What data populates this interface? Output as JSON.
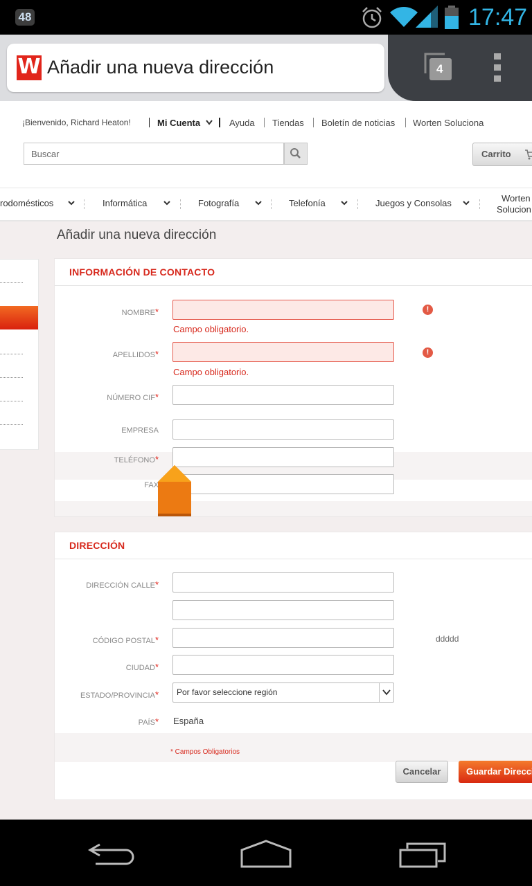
{
  "status_bar": {
    "notification_count": "48",
    "time": "17:47",
    "icons": [
      "alarm-icon",
      "wifi-icon",
      "signal-icon",
      "battery-icon"
    ]
  },
  "browser": {
    "tab_title": "Añadir una nueva dirección",
    "tab_count": "4",
    "logo_letter": "W"
  },
  "header": {
    "welcome": "¡Bienvenido, Richard Heaton!",
    "account": "Mi Cuenta",
    "links": [
      "Ayuda",
      "Tiendas",
      "Boletín de noticias",
      "Worten Soluciona"
    ],
    "search_placeholder": "Buscar",
    "cart": "Carrito"
  },
  "categories": [
    "rodomésticos",
    "Informática",
    "Fotografía",
    "Telefonía",
    "Juegos y Consolas",
    "Worten",
    "Solucion"
  ],
  "page_title": "Añadir una nueva dirección",
  "contact": {
    "title": "INFORMACIÓN DE CONTACTO",
    "nombre": "NOMBRE",
    "apellidos": "APELLIDOS",
    "cif": "NÚMERO CIF",
    "empresa": "EMPRESA",
    "telefono": "TELÉFONO",
    "fax": "FAX",
    "required_star": "*",
    "error_text": "Campo obligatorio.",
    "error_icon": "!"
  },
  "address": {
    "title": "DIRECCIÓN",
    "calle": "DIRECCIÓN CALLE",
    "cp": "CÓDIGO POSTAL",
    "cp_hint": "ddddd",
    "ciudad": "CIUDAD",
    "estado": "ESTADO/PROVINCIA",
    "region_select": "Por favor seleccione región",
    "pais": "PAÍS",
    "pais_value": "España"
  },
  "footer": {
    "required_note": "* Campos Obligatorios",
    "cancel": "Cancelar",
    "save": "Guardar Dirección"
  },
  "colors": {
    "brand": "#e1251b",
    "status_accent": "#33b5e5",
    "save_button": "#e84e1b"
  }
}
